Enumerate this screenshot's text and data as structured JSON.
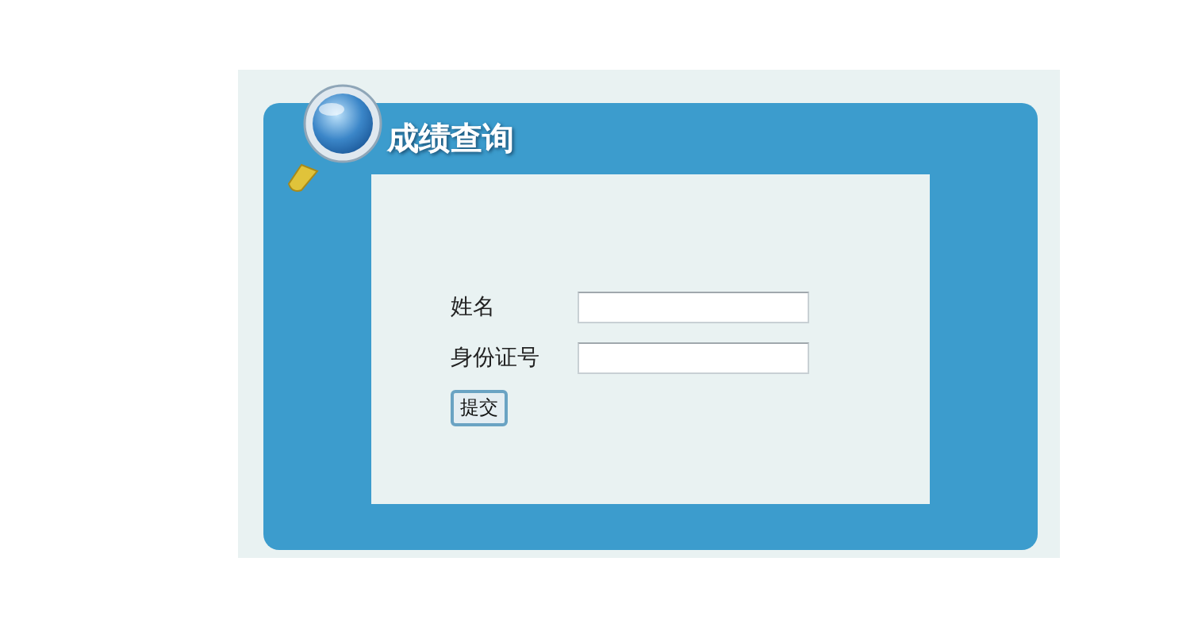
{
  "header": {
    "title": "成绩查询"
  },
  "form": {
    "fields": [
      {
        "label": "姓名"
      },
      {
        "label": "身份证号"
      }
    ],
    "submit": "提交"
  }
}
